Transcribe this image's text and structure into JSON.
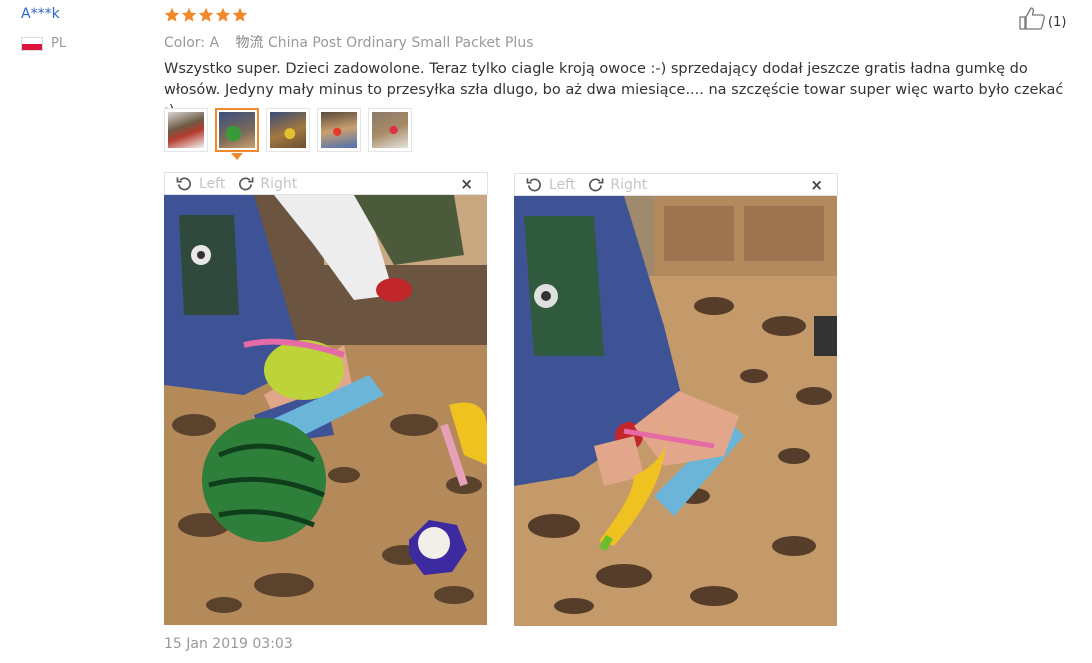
{
  "review": {
    "user": "A***k",
    "country": "PL",
    "rating": 5,
    "helpful_count": "(1)",
    "color_label": "Color: A",
    "shipping_label": "物流",
    "shipping_value": "China Post Ordinary Small Packet Plus",
    "text": "Wszystko super. Dzieci zadowolone. Teraz tylko ciagle kroją owoce :-) sprzedający dodał jeszcze gratis ładna gumkę do włosów. Jedyny mały minus to przesyłka szła dlugo, bo aż dwa miesiące.... na szczęście towar super więc warto było czekać :)",
    "date": "15 Jan 2019 03:03"
  },
  "viewer": {
    "rotate_left": "Left",
    "rotate_right": "Right",
    "close": "×"
  },
  "colors": {
    "username": "#2c66c8",
    "star": "#f0892b",
    "active_thumb": "#f0892b"
  }
}
